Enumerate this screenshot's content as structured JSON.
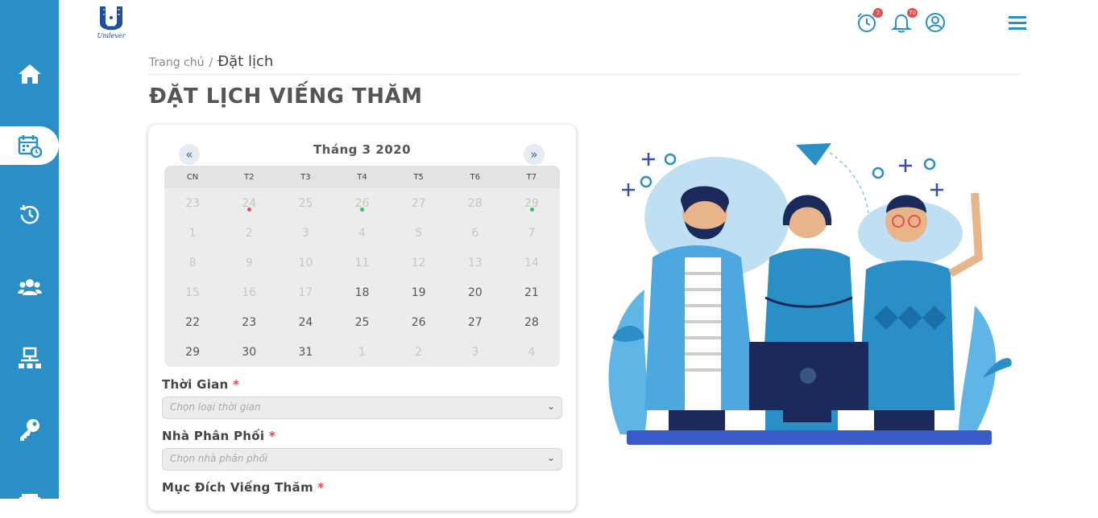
{
  "app": {
    "logo_text": "Unilever"
  },
  "header": {
    "alarm_badge": "2",
    "bell_badge": "70"
  },
  "sidebar": {
    "items": [
      {
        "name": "home-icon"
      },
      {
        "name": "calendar-icon",
        "active": true
      },
      {
        "name": "history-icon"
      },
      {
        "name": "users-icon"
      },
      {
        "name": "network-icon"
      },
      {
        "name": "key-icon"
      },
      {
        "name": "printer-icon"
      }
    ]
  },
  "breadcrumb": {
    "home": "Trang chủ",
    "separator": "/",
    "current": "Đặt lịch"
  },
  "page": {
    "title": "ĐẶT LỊCH VIẾNG THĂM"
  },
  "calendar": {
    "prev": "«",
    "next": "»",
    "month_label": "Tháng 3 2020",
    "weekdays": [
      "CN",
      "T2",
      "T3",
      "T4",
      "T5",
      "T6",
      "T7"
    ],
    "weeks": [
      [
        "23",
        "24",
        "25",
        "26",
        "27",
        "28",
        "29"
      ],
      [
        "1",
        "2",
        "3",
        "4",
        "5",
        "6",
        "7"
      ],
      [
        "8",
        "9",
        "10",
        "11",
        "12",
        "13",
        "14"
      ],
      [
        "15",
        "16",
        "17",
        "18",
        "19",
        "20",
        "21"
      ],
      [
        "22",
        "23",
        "24",
        "25",
        "26",
        "27",
        "28"
      ],
      [
        "29",
        "30",
        "31",
        "1",
        "2",
        "3",
        "4"
      ]
    ]
  },
  "form": {
    "time": {
      "label": "Thời Gian",
      "required": "*",
      "placeholder": "Chọn loại thời gian"
    },
    "distributor": {
      "label": "Nhà Phân Phối",
      "required": "*",
      "placeholder": "Chọn nhà phân phối"
    },
    "purpose": {
      "label": "Mục Đích Viếng Thăm",
      "required": "*"
    }
  },
  "colors": {
    "sidebar": "#2a8fc7",
    "accent": "#2a8fc7",
    "dot_red": "#e15050",
    "dot_green": "#3dbf55"
  }
}
